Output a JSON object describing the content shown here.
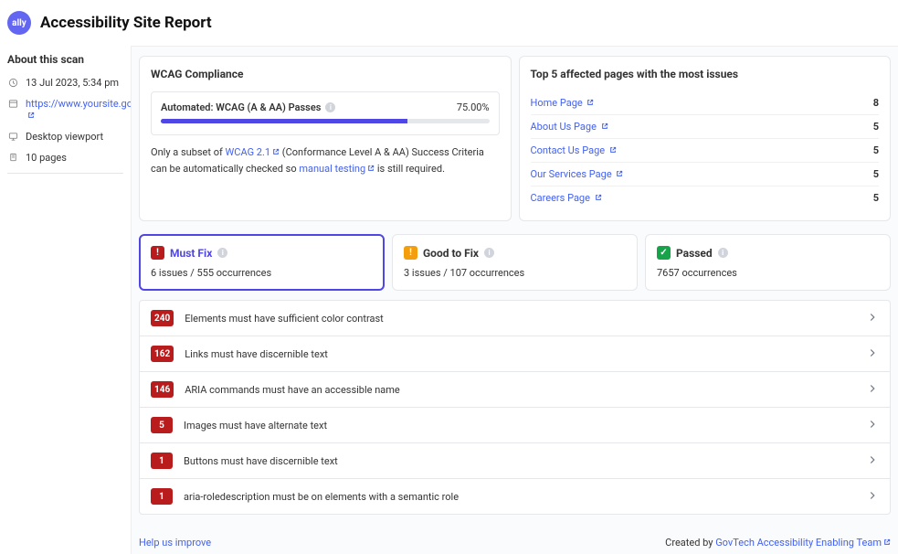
{
  "header": {
    "title": "Accessibility Site Report",
    "logo_text": "ally"
  },
  "scan": {
    "heading": "About this scan",
    "date": "13 Jul 2023, 5:34 pm",
    "url": "https://www.yoursite.gov.sg/",
    "viewport": "Desktop viewport",
    "pages": "10 pages"
  },
  "wcag": {
    "card_title": "WCAG Compliance",
    "progress_label": "Automated: WCAG (A & AA) Passes",
    "progress_value": "75.00%",
    "progress_pct": 75,
    "note_prefix": "Only a subset of ",
    "note_link1": "WCAG 2.1",
    "note_middle": " (Conformance Level A & AA) Success Criteria can be automatically checked so ",
    "note_link2": "manual testing",
    "note_suffix": " is still required."
  },
  "affected": {
    "card_title": "Top 5 affected pages with the most issues",
    "items": [
      {
        "page": "Home Page",
        "count": "8"
      },
      {
        "page": "About Us Page",
        "count": "5"
      },
      {
        "page": "Contact Us Page",
        "count": "5"
      },
      {
        "page": "Our Services Page",
        "count": "5"
      },
      {
        "page": "Careers Page",
        "count": "5"
      }
    ]
  },
  "tabs": {
    "mustfix": {
      "label": "Must Fix",
      "subtitle": "6 issues / 555 occurrences",
      "icon": "!"
    },
    "goodtofix": {
      "label": "Good to Fix",
      "subtitle": "3 issues / 107 occurrences",
      "icon": "!"
    },
    "passed": {
      "label": "Passed",
      "subtitle": "7657 occurrences",
      "icon": "✓"
    }
  },
  "issues": [
    {
      "count": "240",
      "text": "Elements must have sufficient color contrast"
    },
    {
      "count": "162",
      "text": "Links must have discernible text"
    },
    {
      "count": "146",
      "text": "ARIA commands must have an accessible name"
    },
    {
      "count": "5",
      "text": "Images must have alternate text"
    },
    {
      "count": "1",
      "text": "Buttons must have discernible text"
    },
    {
      "count": "1",
      "text": "aria-roledescription must be on elements with a semantic role"
    }
  ],
  "footer": {
    "help": "Help us improve",
    "created_prefix": "Created by ",
    "created_link": "GovTech Accessibility Enabling Team"
  }
}
